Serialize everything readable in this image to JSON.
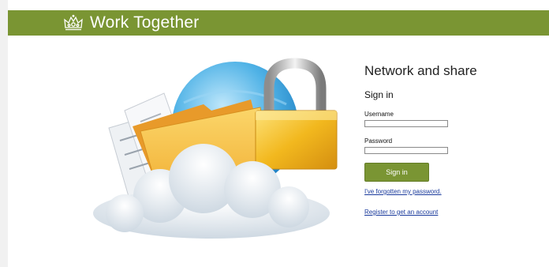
{
  "header": {
    "brand_name": "Work Together",
    "brand_icon": "crown-icon",
    "color": "#7a9533"
  },
  "illustration": {
    "icons": [
      "globe-icon",
      "documents-icon",
      "folder-icon",
      "padlock-icon",
      "cloud-icon"
    ]
  },
  "login": {
    "title": "Network and share",
    "heading": "Sign in",
    "username_label": "Username",
    "username_value": "",
    "password_label": "Password",
    "password_value": "",
    "submit_label": "Sign in",
    "forgot_link": "I've forgotten my password.",
    "register_link": "Register to get an account"
  },
  "colors": {
    "accent": "#7a9533",
    "link": "#1a3a9c"
  }
}
